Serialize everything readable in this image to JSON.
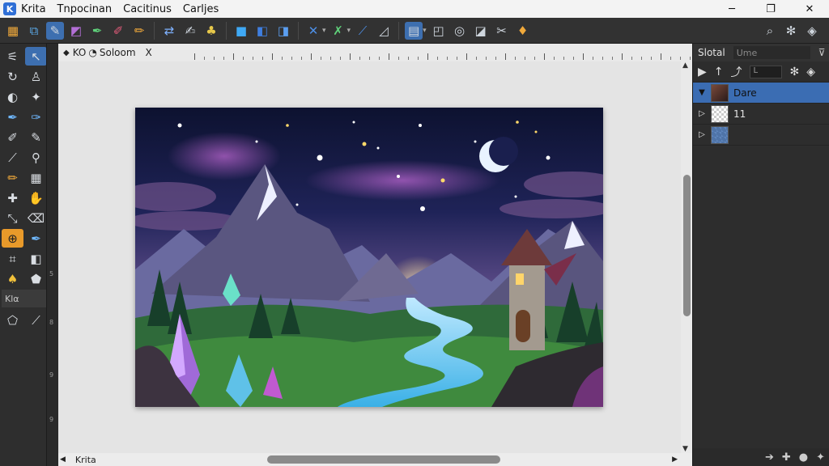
{
  "titlebar": {
    "app_name": "Krita",
    "menus": [
      "Tnpocinan",
      "Cacitinus",
      "Carljes"
    ],
    "minimize_glyph": "─",
    "maximize_glyph": "❐",
    "close_glyph": "✕"
  },
  "toolbar": {
    "groups": [
      [
        "new-document-icon",
        "open-icon",
        "brush-preset-icon",
        "gradient-icon",
        "pen-icon",
        "marker-icon",
        "pencil-icon"
      ],
      [
        "transform-icon",
        "edit-icon",
        "palette-icon"
      ],
      [
        "square-icon",
        "layers-icon",
        "blend-icon"
      ],
      [
        "cross-icon",
        "pen-angle-icon",
        "line-icon",
        "slash-icon"
      ],
      [
        "frame-icon",
        "copy-icon",
        "layout-icon",
        "stack-icon",
        "crosshair-icon",
        "bucket-icon"
      ]
    ],
    "right_icons": [
      "search-icon",
      "settings-icon",
      "toolbox-icon"
    ]
  },
  "document": {
    "tab_label": "KO",
    "tab_zoom": "Soloom",
    "tab_close": "X"
  },
  "toolbox": {
    "tools": [
      [
        "freehand-icon",
        "select-arrow-icon"
      ],
      [
        "transform-rotate-icon",
        "move-icon"
      ],
      [
        "ellipse-icon",
        "brush-icon"
      ],
      [
        "pen-icon",
        "ink-pen-icon"
      ],
      [
        "smudge-icon",
        "airbrush-icon"
      ],
      [
        "knife-icon",
        "clone-icon"
      ],
      [
        "pencil-icon",
        "grid-icon"
      ],
      [
        "plus-icon",
        "fill-icon"
      ],
      [
        "measure-icon",
        "eraser-icon"
      ],
      [
        "zoom-icon",
        "pen-blue-icon"
      ],
      [
        "crop-icon",
        "filter-icon"
      ],
      [
        "bucket-icon",
        "shape-icon"
      ]
    ],
    "label": "Κlα",
    "extra": [
      "shape-icon",
      "line-icon"
    ],
    "ruler_marks": [
      "5",
      "8",
      "9",
      "9"
    ]
  },
  "statusbar": {
    "label": "Krita"
  },
  "docker": {
    "title": "Slotal",
    "search_placeholder": "Ume",
    "menu_glyph": "⊽",
    "filter_value": "L",
    "layers": [
      {
        "name": "Dare",
        "selected": true,
        "thumb": "art"
      },
      {
        "name": "11",
        "selected": false,
        "thumb": "check"
      },
      {
        "name": "",
        "selected": false,
        "thumb": "blue"
      }
    ]
  },
  "colors": {
    "accent": "#3d6fb0",
    "active_tool": "#e99a2a",
    "canvas_bg": "#e4e4e4",
    "panel_bg": "#2d2d2d"
  }
}
